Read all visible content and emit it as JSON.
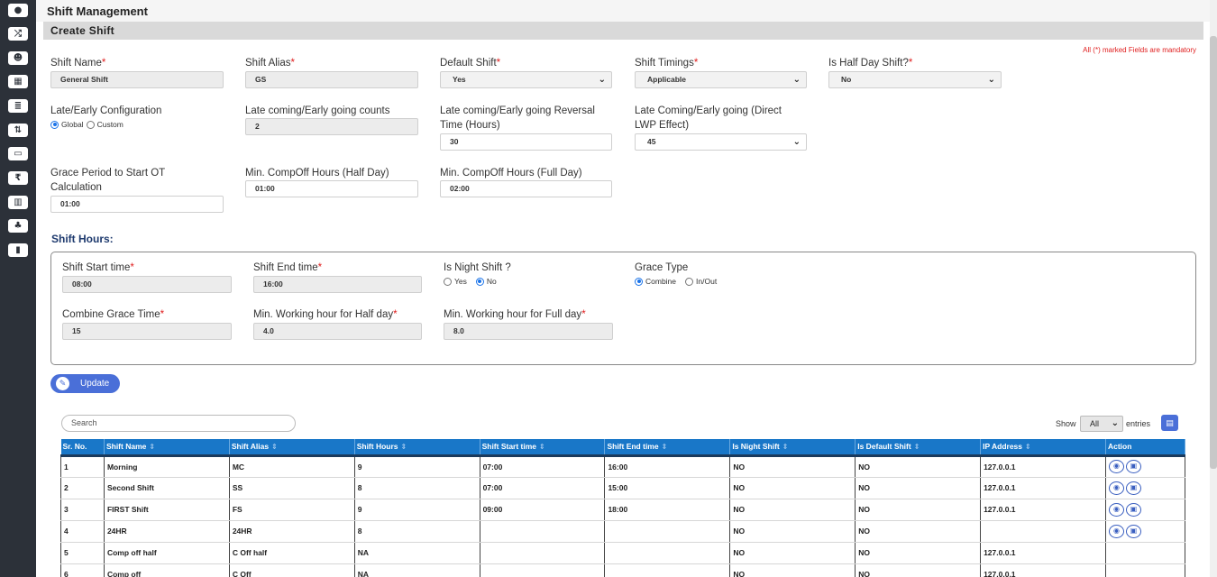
{
  "sidebar": {
    "icons": [
      "info-circle-icon",
      "shuffle-icon",
      "users-icon",
      "calendar-icon",
      "list-icon",
      "sort-icon",
      "money-icon",
      "rupee-icon",
      "bar-chart-icon",
      "sitemap-icon",
      "bookmark-icon"
    ],
    "glyphs": [
      "●",
      "⤮",
      "☻",
      "▦",
      "≣",
      "⇅",
      "▭",
      "₹",
      "▥",
      "♣",
      "▮"
    ]
  },
  "header": {
    "title": "Shift Management",
    "section": "Create Shift"
  },
  "mandatory_note": "All (*) marked Fields are mandatory",
  "form": {
    "shift_name": {
      "label": "Shift Name",
      "value": "General Shift"
    },
    "shift_alias": {
      "label": "Shift Alias",
      "value": "GS"
    },
    "default_shift": {
      "label": "Default Shift",
      "value": "Yes"
    },
    "shift_timings": {
      "label": "Shift Timings",
      "value": "Applicable"
    },
    "half_day": {
      "label": "Is Half Day Shift?",
      "value": "No"
    },
    "late_config": {
      "label": "Late/Early Configuration",
      "opt_global": "Global",
      "opt_custom": "Custom"
    },
    "late_counts": {
      "label": "Late coming/Early going counts",
      "value": "2"
    },
    "reversal_time": {
      "label1": "Late coming/Early going Reversal",
      "label2": "Time (Hours)",
      "value": "30"
    },
    "lwp_effect": {
      "label1": "Late Coming/Early going (Direct",
      "label2": "LWP Effect)",
      "value": "45"
    },
    "grace_ot": {
      "label1": "Grace Period to Start OT",
      "label2": "Calculation",
      "value": "01:00"
    },
    "compoff_half": {
      "label": "Min. CompOff Hours (Half Day)",
      "value": "01:00"
    },
    "compoff_full": {
      "label": "Min. CompOff Hours (Full Day)",
      "value": "02:00"
    }
  },
  "hours": {
    "title": "Shift Hours:",
    "start": {
      "label": "Shift Start time",
      "value": "08:00"
    },
    "end": {
      "label": "Shift End time",
      "value": "16:00"
    },
    "night": {
      "label": "Is Night Shift ?",
      "opt_yes": "Yes",
      "opt_no": "No"
    },
    "grace_type": {
      "label": "Grace Type",
      "opt_combine": "Combine",
      "opt_inout": "In/Out"
    },
    "combine_grace": {
      "label": "Combine Grace Time",
      "value": "15"
    },
    "min_half": {
      "label": "Min. Working hour for Half day",
      "value": "4.0"
    },
    "min_full": {
      "label": "Min. Working hour for Full day",
      "value": "8.0"
    }
  },
  "update_button": "Update",
  "table_controls": {
    "search_placeholder": "Search",
    "show_label": "Show",
    "show_value": "All",
    "entries_label": "entries"
  },
  "table": {
    "columns": [
      "Sr. No.",
      "Shift Name",
      "Shift Alias",
      "Shift Hours",
      "Shift Start time",
      "Shift End time",
      "Is Night Shift",
      "Is Default Shift",
      "IP Address",
      "Action"
    ],
    "rows": [
      [
        "1",
        "Morning",
        "MC",
        "9",
        "07:00",
        "16:00",
        "NO",
        "NO",
        "127.0.0.1"
      ],
      [
        "2",
        "Second Shift",
        "SS",
        "8",
        "07:00",
        "15:00",
        "NO",
        "NO",
        "127.0.0.1"
      ],
      [
        "3",
        "FIRST Shift",
        "FS",
        "9",
        "09:00",
        "18:00",
        "NO",
        "NO",
        "127.0.0.1"
      ],
      [
        "4",
        "24HR",
        "24HR",
        "8",
        "",
        "",
        "NO",
        "NO",
        ""
      ],
      [
        "5",
        "Comp off half",
        "C Off half",
        "NA",
        "",
        "",
        "NO",
        "NO",
        "127.0.0.1"
      ],
      [
        "6",
        "Comp off",
        "C Off",
        "NA",
        "",
        "",
        "NO",
        "NO",
        "127.0.0.1"
      ]
    ],
    "action_rows": [
      true,
      true,
      true,
      true,
      false,
      false
    ]
  },
  "colors": {
    "sidebar": "#2c3139",
    "accent": "#4a6fd8",
    "table_header": "#1977c8",
    "required": "#e02020"
  }
}
